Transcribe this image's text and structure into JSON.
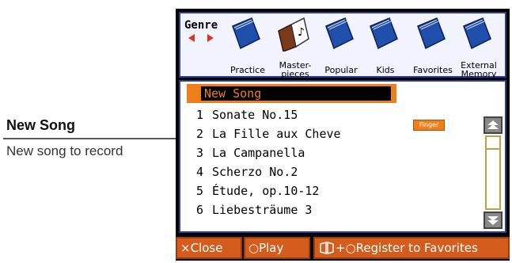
{
  "callout": {
    "title": "New Song",
    "description": "New song to record"
  },
  "genre": {
    "label": "Genre",
    "items": [
      {
        "caption": "Practice",
        "icon": "book-icon"
      },
      {
        "caption": "Master-\npieces",
        "icon": "open-book-icon"
      },
      {
        "caption": "Popular",
        "icon": "book-icon"
      },
      {
        "caption": "Kids",
        "icon": "book-icon"
      },
      {
        "caption": "Favorites",
        "icon": "book-icon"
      },
      {
        "caption": "External\nMemory",
        "icon": "book-icon"
      }
    ]
  },
  "songs": {
    "new_song_label": "New Song",
    "items": [
      {
        "num": "1",
        "title": "Sonate No.15"
      },
      {
        "num": "2",
        "title": "La Fille aux Cheve"
      },
      {
        "num": "3",
        "title": "La Campanella"
      },
      {
        "num": "4",
        "title": "Scherzo No.2"
      },
      {
        "num": "5",
        "title": "Étude, op.10-12"
      },
      {
        "num": "6",
        "title": "Liebesträume 3"
      }
    ],
    "badge": "Finger"
  },
  "buttons": {
    "close": "×Close",
    "play": "○Play",
    "register": "+○Register to Favorites"
  },
  "colors": {
    "accent": "#ee7f1a",
    "frame": "#2a3f8f",
    "button": "#d45c1c"
  }
}
